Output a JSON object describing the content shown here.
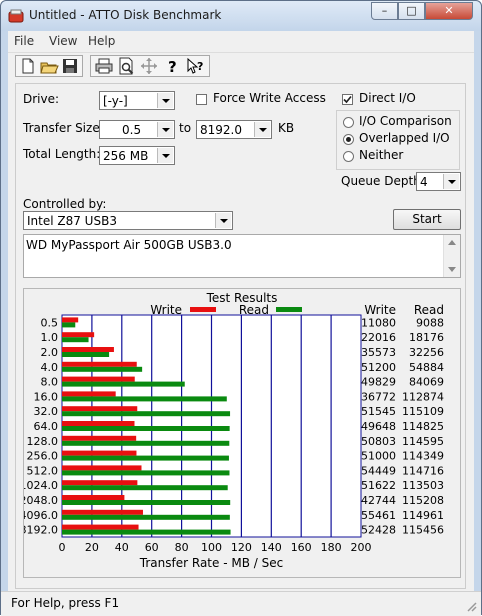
{
  "window": {
    "title": "Untitled - ATTO Disk Benchmark"
  },
  "menu": [
    "File",
    "View",
    "Help"
  ],
  "toolbar": [
    "new-icon",
    "open-icon",
    "save-icon",
    "print-icon",
    "print-preview-icon",
    "move-icon",
    "help-icon",
    "context-help-icon"
  ],
  "settings": {
    "drive_label": "Drive:",
    "drive_value": "[-y-]",
    "force_write_label": "Force Write Access",
    "direct_io_label": "Direct I/O",
    "transfer_size_label": "Transfer Size:",
    "transfer_from": "0.5",
    "to_label": "to",
    "transfer_to": "8192.0",
    "unit_label": "KB",
    "total_length_label": "Total Length:",
    "total_length_value": "256 MB",
    "io_comparison_label": "I/O Comparison",
    "overlapped_io_label": "Overlapped I/O",
    "neither_label": "Neither",
    "queue_depth_label": "Queue Depth:",
    "queue_depth_value": "4",
    "controlled_by_label": "Controlled by:",
    "controlled_by_value": "Intel Z87 USB3",
    "start_label": "Start",
    "description": "WD MyPassport Air 500GB USB3.0"
  },
  "state": {
    "force_write": false,
    "direct_io": true,
    "io_mode": "Overlapped I/O"
  },
  "colors": {
    "write": "#e81010",
    "read": "#0a8a10",
    "grid": "#10109a"
  },
  "chart_data": {
    "type": "bar",
    "title": "Test Results",
    "xlabel": "Transfer Rate - MB / Sec",
    "xlim": [
      0,
      200
    ],
    "xticks": [
      0,
      20,
      40,
      60,
      80,
      100,
      120,
      140,
      160,
      180,
      200
    ],
    "legend": [
      "Write",
      "Read"
    ],
    "column_headers": [
      "Write",
      "Read"
    ],
    "categories": [
      "0.5",
      "1.0",
      "2.0",
      "4.0",
      "8.0",
      "16.0",
      "32.0",
      "64.0",
      "128.0",
      "256.0",
      "512.0",
      "1024.0",
      "2048.0",
      "4096.0",
      "8192.0"
    ],
    "series": [
      {
        "name": "Write",
        "values": [
          11080,
          22016,
          35573,
          51200,
          49829,
          36772,
          51545,
          49648,
          50803,
          51000,
          54449,
          51622,
          42744,
          55461,
          52428
        ]
      },
      {
        "name": "Read",
        "values": [
          9088,
          18176,
          32256,
          54884,
          84069,
          112874,
          115109,
          114825,
          114595,
          114349,
          114716,
          113503,
          115208,
          114961,
          115456
        ]
      }
    ]
  },
  "status": "For Help, press F1"
}
